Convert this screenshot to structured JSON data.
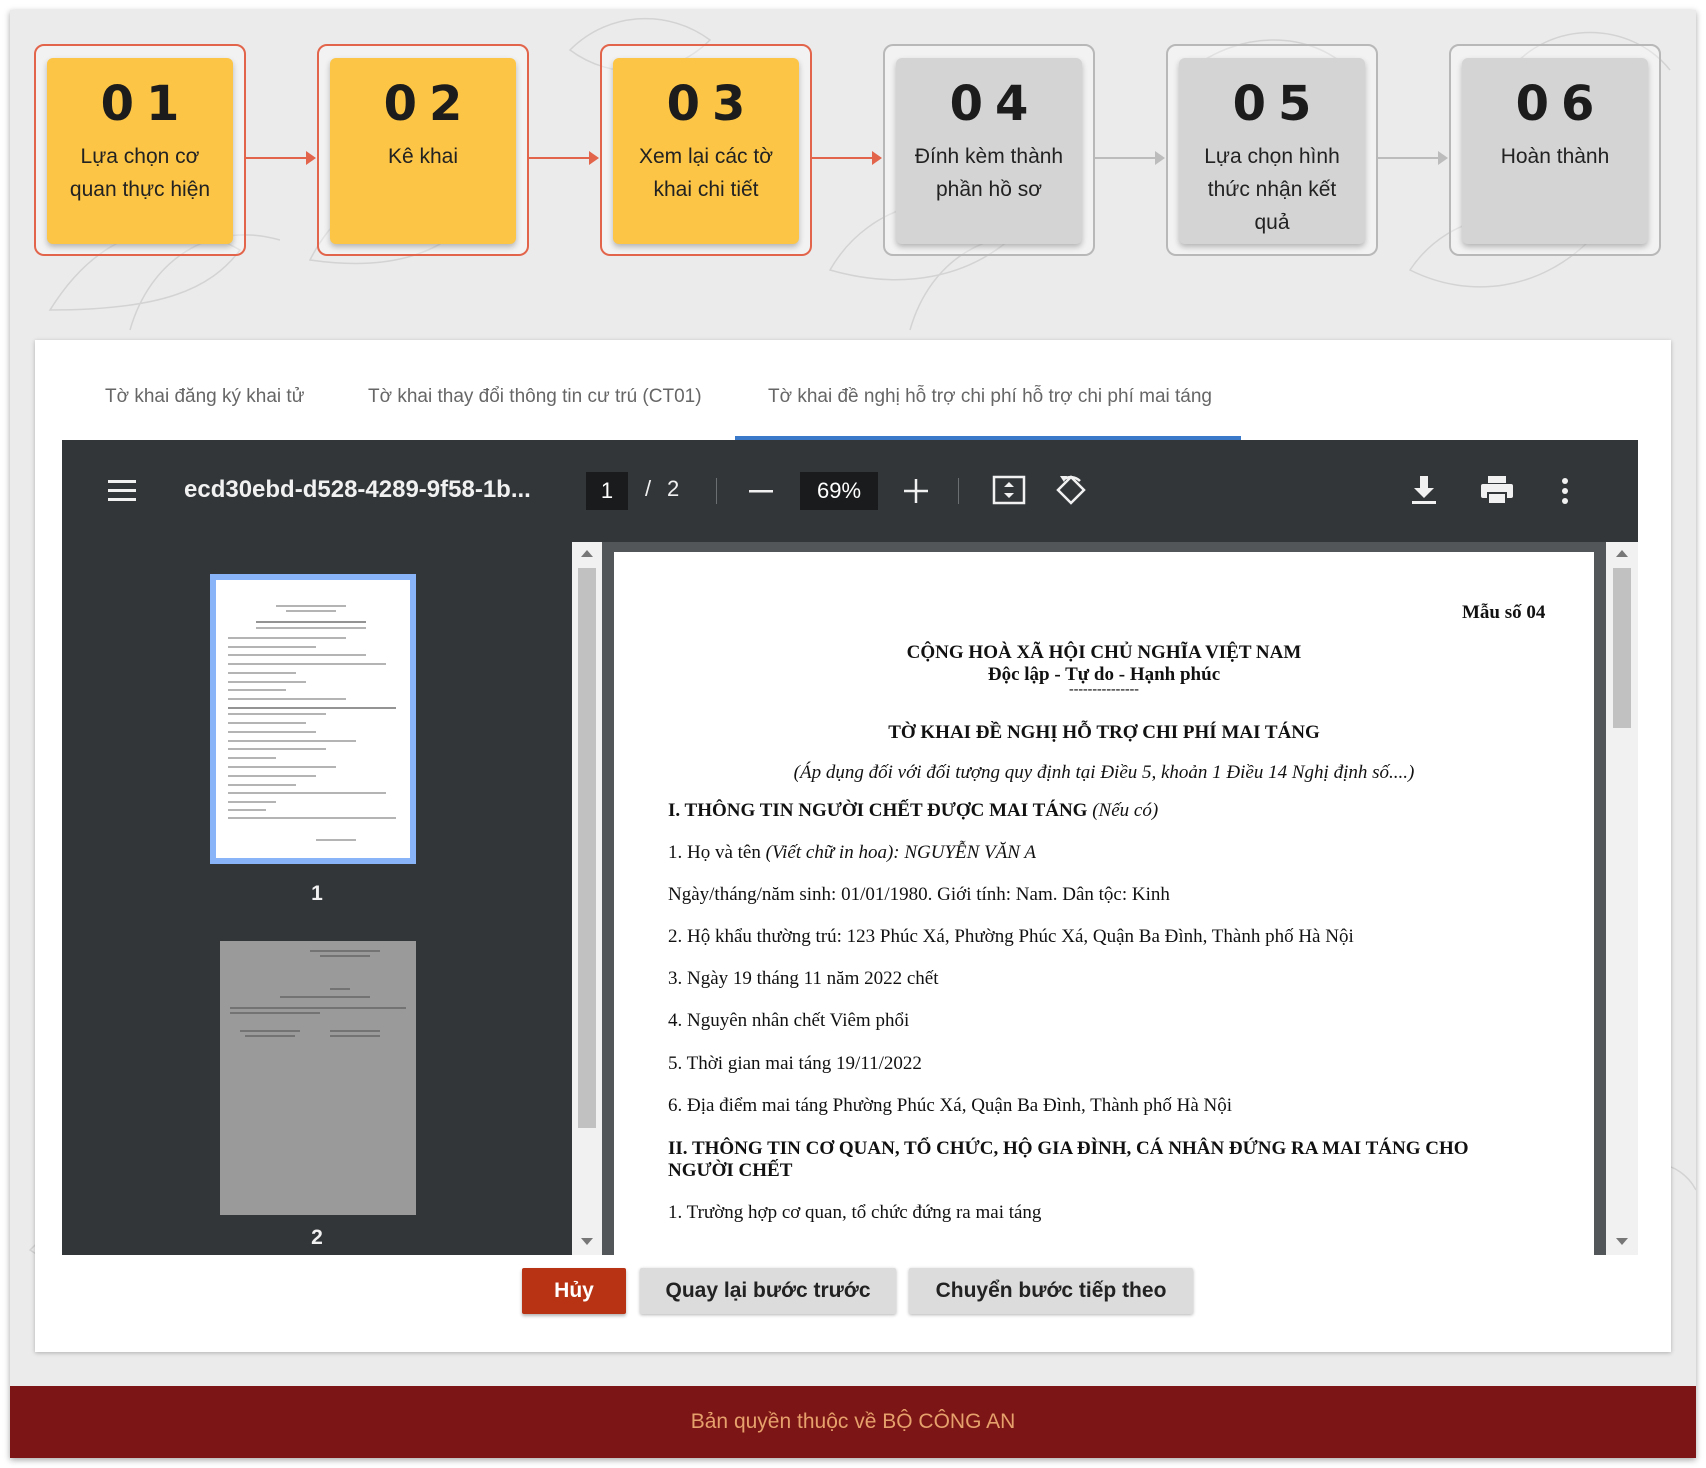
{
  "steps": [
    {
      "num": "01",
      "label": "Lựa chọn cơ quan thực hiện",
      "state": "done"
    },
    {
      "num": "02",
      "label": "Kê khai",
      "state": "done"
    },
    {
      "num": "03",
      "label": "Xem lại các tờ khai chi tiết",
      "state": "active"
    },
    {
      "num": "04",
      "label": "Đính kèm thành phần hồ sơ",
      "state": "pending"
    },
    {
      "num": "05",
      "label": "Lựa chọn hình thức nhận kết quả",
      "state": "pending"
    },
    {
      "num": "06",
      "label": "Hoàn thành",
      "state": "pending"
    }
  ],
  "tabs": [
    {
      "label": "Tờ khai đăng ký khai tử",
      "active": false
    },
    {
      "label": "Tờ khai thay đổi thông tin cư trú (CT01)",
      "active": false
    },
    {
      "label": "Tờ khai đề nghị hỗ trợ chi phí hỗ trợ chi phí mai táng",
      "active": true
    }
  ],
  "viewer": {
    "filename": "ecd30ebd-d528-4289-9f58-1b...",
    "page_current": "1",
    "page_separator": "/",
    "page_total": "2",
    "zoom": "69%",
    "thumb_label_1": "1",
    "thumb_label_2": "2",
    "icons": [
      "menu-icon",
      "zoom-out-icon",
      "zoom-in-icon",
      "fit-page-icon",
      "rotate-icon",
      "download-icon",
      "print-icon",
      "more-vert-icon"
    ]
  },
  "document": {
    "form_no": "Mẫu số 04",
    "country": "CỘNG HOÀ XÃ HỘI CHỦ NGHĨA VIỆT NAM",
    "motto": "Độc lập - Tự do - Hạnh phúc",
    "motto_rule": "---------------",
    "title": "TỜ KHAI ĐỀ NGHỊ HỖ TRỢ CHI PHÍ MAI TÁNG",
    "subtitle": "(Áp dụng đối với đối tượng quy định tại Điều 5, khoản 1 Điều 14 Nghị định số....)",
    "section1_title": "I. THÔNG TIN NGƯỜI CHẾT ĐƯỢC MAI TÁNG",
    "section1_note": "(Nếu có)",
    "line1_prefix": "1. Họ và tên",
    "line1_value": "(Viết chữ in hoa): NGUYỄN VĂN A",
    "line2": "Ngày/tháng/năm sinh: 01/01/1980. Giới tính: Nam. Dân tộc: Kinh",
    "line3": "2. Hộ khẩu thường trú:  123 Phúc Xá, Phường Phúc Xá, Quận Ba Đình, Thành phố Hà Nội",
    "line4": "3. Ngày 19 tháng 11 năm 2022 chết",
    "line5": "4. Nguyên nhân chết Viêm phổi",
    "line6": "5. Thời gian mai táng 19/11/2022",
    "line7": "6. Địa điểm mai táng Phường Phúc Xá, Quận Ba Đình, Thành phố Hà Nội",
    "section2_title_a": "II. THÔNG TIN CƠ QUAN, TỔ CHỨC, HỘ GIA ĐÌNH, CÁ NHÂN ĐỨNG RA MAI TÁNG CHO",
    "section2_title_b": "NGƯỜI CHẾT",
    "line8": "1. Trường hợp cơ quan, tổ chức đứng ra mai táng"
  },
  "buttons": {
    "cancel": "Hủy",
    "back": "Quay lại bước trước",
    "next": "Chuyển bước tiếp theo"
  },
  "footer": {
    "text": "Bản quyền thuộc về BỘ CÔNG AN"
  },
  "colors": {
    "step_done": "#fcc545",
    "step_pending": "#d4d4d4",
    "step_border_active": "#e2644a",
    "tab_active": "#3a78c9",
    "cancel_button": "#b73314",
    "footer_bg": "#7c1515",
    "footer_text": "#e5a06b"
  }
}
